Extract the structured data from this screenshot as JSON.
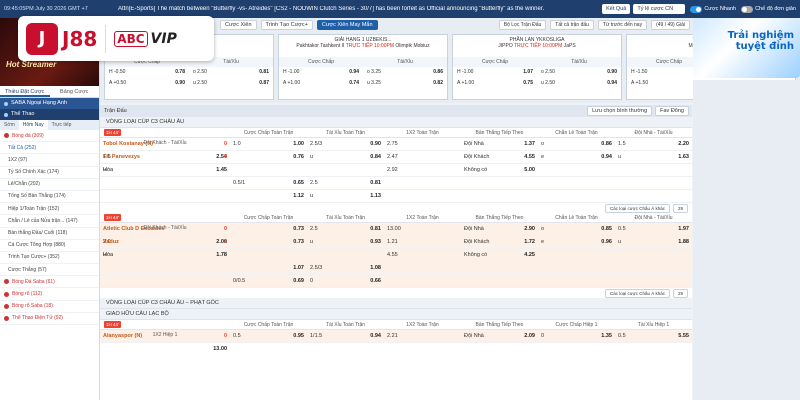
{
  "topbar": {
    "clock": "09:45:05PM July 30 2026 GMT +7",
    "ticker": "Attn[E-Sports] The match between \"Butterfly -vs- Atreides\" [CS2 - NODWIN Clutch Series - 30/7] has been forfeit as Official announcing \"Butterfly\" as the winner.",
    "refresh_label": "Kết Quả",
    "odds_type": "Tỷ lệ cược CN",
    "quick_bet_label": "Cược Nhanh",
    "simple_mode_label": "Chế độ đơn giản"
  },
  "logo": {
    "mark": "J",
    "brand": "J88",
    "abc": "ABC",
    "vip": "VIP"
  },
  "sidebar": {
    "promo_text": "Hot Streamer",
    "tabs": [
      "Thiều Đặt Cược",
      "Bảng Cược"
    ],
    "saba_head": "SABA Ngoại Hạng Anh",
    "sports_head": "Thể Thao",
    "subtabs": [
      "Sớm",
      "Hôm Nay",
      "Trực tiếp"
    ],
    "items": [
      {
        "label": "Bóng đá (309)",
        "type": "hot"
      },
      {
        "label": "Tất Cả (252)",
        "type": "sel"
      },
      {
        "label": "1X2 (97)",
        "type": "normal"
      },
      {
        "label": "Tỷ Số Chính Xác (174)",
        "type": "normal"
      },
      {
        "label": "Lẻ/Chẵn (202)",
        "type": "normal"
      },
      {
        "label": "Tổng Số Bàn Thắng (174)",
        "type": "normal"
      },
      {
        "label": "Hiệp 1/Toàn Trận (152)",
        "type": "normal"
      },
      {
        "label": "Chẵn / Lẻ của Nửa trận... (147)",
        "type": "normal"
      },
      {
        "label": "Bàn thắng Đầu/ Cuối (118)",
        "type": "normal"
      },
      {
        "label": "Cá Cược Tổng Hợp (880)",
        "type": "normal"
      },
      {
        "label": "Trình Tạo Cược+ (352)",
        "type": "normal"
      },
      {
        "label": "Cược Thắng (57)",
        "type": "normal"
      },
      {
        "label": "Bóng Đá Saba (61)",
        "type": "hot"
      },
      {
        "label": "Bóng rổ (112)",
        "type": "hot"
      },
      {
        "label": "Bóng rổ Saba (18)",
        "type": "hot"
      },
      {
        "label": "Thể Thao Điện Tử (92)",
        "type": "hot"
      }
    ]
  },
  "strip": {
    "chips": [
      "Cược Xiên",
      "Trình Tạo Cược+",
      "Cược Xiên May Mắn"
    ],
    "right_chips": [
      "Bộ Lọc Trận Đấu",
      "Tất cả trận đấu",
      "Từ trước đến nay",
      "(49 / 49) Giải"
    ],
    "cards": [
      {
        "league": "CÂU LẠC BỘ",
        "home": "",
        "away": "Arezzo",
        "status": "",
        "h1": "Cược Chấp",
        "h2": "Tài/Xỉu",
        "r1": [
          "H -0.50",
          "0.78",
          "o 2.50",
          "0.81"
        ],
        "r2": [
          "A +0.50",
          "0.90",
          "u 2.50",
          "0.87"
        ]
      },
      {
        "league": "GIẢI HẠNG 1 UZBEKIS...",
        "home": "Pakhtakor Tashkent II",
        "away": "Olimpik Mobiuz",
        "status": "TRỰC TIẾP 10:00PM",
        "h1": "Cược Chấp",
        "h2": "Tài/Xỉu",
        "r1": [
          "H -1.00",
          "0.94",
          "o 3.25",
          "0.86"
        ],
        "r2": [
          "A +1.00",
          "0.74",
          "u 3.25",
          "0.82"
        ]
      },
      {
        "league": "PHẦN LAN YKKOSLIGA",
        "home": "JIPPO",
        "away": "JaPS",
        "status": "TRỰC TIẾP 10:00PM",
        "h1": "Cược Chấp",
        "h2": "Tài/Xỉu",
        "r1": [
          "H -1.00",
          "1.07",
          "o 2.50",
          "0.90"
        ],
        "r2": [
          "A +1.00",
          "0.75",
          "u 2.50",
          "0.94"
        ]
      },
      {
        "league": "VÔNG LOẠI C...",
        "home": "Maccabi Tel Aviv (N)",
        "away": "",
        "status": "",
        "h1": "Cược Chấp",
        "h2": "",
        "r1": [
          "H -1.50",
          "0.86",
          "",
          ""
        ],
        "r2": [
          "A +1.50",
          "0.90",
          "",
          ""
        ]
      }
    ]
  },
  "rpromo": {
    "line1": "Trải nghiệm",
    "line2": "tuyệt đỉnh"
  },
  "main": {
    "filter_label": "Trận Đấu",
    "sort_label": "Lưu chọn bình thường",
    "sort2_label": "Fav Đông",
    "columns": [
      "",
      "Cược Chấp Toàn Trận",
      "Tài Xỉu Toàn Trận",
      "1X2 Toàn Trận",
      "Bàn Thắng Tiếp Theo",
      "Chẵn Lẻ Toàn Trận",
      "Đội Nhà - Tài/Xỉu",
      "Đội Khách - Tài/Xỉu"
    ],
    "more_label": "Các loại cược Châu Á khác",
    "more_count": "29",
    "group1": "VÒNG LOẠI CÚP C3 CHÂU ÂU",
    "group2": "VÒNG LOẠI CÚP C3 CHÂU ÂU – PHẠT GÓC",
    "group3": "GIAO HỮU CÂU LẠC BỘ",
    "matches": [
      {
        "time": "1H 44'",
        "rows": [
          [
            "Tobol Kostanay (N)",
            "0",
            "1.0",
            "1.00",
            "2.5/3",
            "0.90",
            "2.75",
            "",
            "Đội Nhà",
            "1.37",
            "o",
            "0.86",
            "1.5",
            "2.20",
            "1.5",
            "2.54"
          ],
          [
            "FK Panevezys",
            "0",
            "",
            "0.76",
            "u",
            "0.84",
            "2.47",
            "",
            "Đội Khách",
            "4.55",
            "e",
            "0.94",
            "u",
            "1.63",
            "u",
            "1.45"
          ],
          [
            "Hòa",
            "",
            "",
            "",
            "",
            "",
            "2.92",
            "",
            "Không có",
            "5.00",
            "",
            "",
            "",
            "",
            "",
            ""
          ],
          [
            "",
            "",
            "0.5/1",
            "0.65",
            "2.5",
            "0.81",
            "",
            "",
            "",
            "",
            "",
            "",
            "",
            "",
            "",
            ""
          ],
          [
            "",
            "",
            "",
            "1.12",
            "u",
            "1.13",
            "",
            "",
            "",
            "",
            "",
            "",
            "",
            "",
            "",
            ""
          ]
        ]
      },
      {
        "time": "1H 44'",
        "rows": [
          [
            "Atletic Club D Escaldes",
            "0",
            "",
            "0.73",
            "2.5",
            "0.81",
            "13.00",
            "",
            "Đội Nhà",
            "2.90",
            "o",
            "0.85",
            "0.5",
            "1.97",
            "2.0",
            "2.00"
          ],
          [
            "Vaduz",
            "1",
            "",
            "0.73",
            "u",
            "0.93",
            "1.21",
            "",
            "Đội Khách",
            "1.72",
            "e",
            "0.96",
            "u",
            "1.88",
            "u",
            "1.78"
          ],
          [
            "Hòa",
            "",
            "",
            "",
            "",
            "",
            "4.55",
            "",
            "Không có",
            "4.25",
            "",
            "",
            "",
            "",
            "",
            ""
          ],
          [
            "",
            "",
            "",
            "1.07",
            "2.5/3",
            "1.08",
            "",
            "",
            "",
            "",
            "",
            "",
            "",
            "",
            "",
            ""
          ],
          [
            "",
            "",
            "0/0.5",
            "0.69",
            "0",
            "0.66",
            "",
            "",
            "",
            "",
            "",
            "",
            "",
            "",
            "",
            ""
          ]
        ]
      }
    ],
    "col_head3": [
      "",
      "Cược Chấp Toàn Trận",
      "Tài Xỉu Toàn Trận",
      "1X2 Toàn Trận",
      "Bàn Thắng Tiếp Theo",
      "Cược Chấp Hiệp 1",
      "Tài Xỉu Hiệp 1",
      "1X2 Hiệp 1"
    ],
    "match3": {
      "time": "1H 44'",
      "row": [
        "Alanyaspor (N)",
        "0",
        "0.5",
        "0.95",
        "1/1.5",
        "0.94",
        "2.21",
        "",
        "Đội Nhà",
        "2.09",
        "0",
        "1.35",
        "0.5",
        "5.55",
        "",
        "13.00"
      ]
    }
  }
}
